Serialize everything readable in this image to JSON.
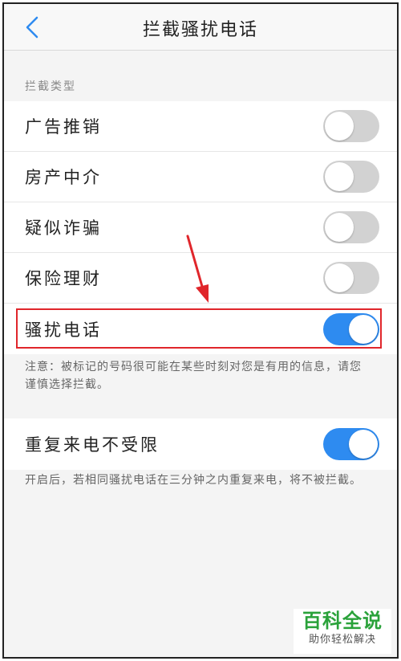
{
  "header": {
    "title": "拦截骚扰电话",
    "back_icon": "chevron-left-icon"
  },
  "section_label": "拦截类型",
  "intercept_types": [
    {
      "label": "广告推销",
      "enabled": false
    },
    {
      "label": "房产中介",
      "enabled": false
    },
    {
      "label": "疑似诈骗",
      "enabled": false
    },
    {
      "label": "保险理财",
      "enabled": false
    },
    {
      "label": "骚扰电话",
      "enabled": true
    }
  ],
  "note1": "注意：被标记的号码很可能在某些时刻对您是有用的信息，请您谨慎选择拦截。",
  "repeat_call": {
    "label": "重复来电不受限",
    "enabled": true
  },
  "note2": "开启后，若相同骚扰电话在三分钟之内重复来电，将不被拦截。",
  "watermark": {
    "title": "百科全说",
    "subtitle": "助你轻松解决"
  },
  "colors": {
    "accent": "#2e8bf0",
    "toggle_off": "#d2d2d2",
    "highlight": "#e0262b",
    "brand_green": "#2aa23a"
  }
}
